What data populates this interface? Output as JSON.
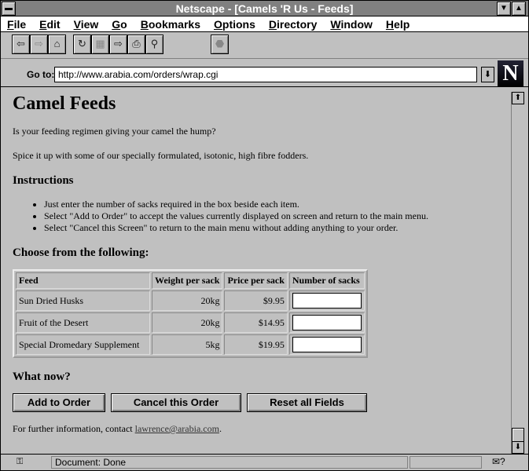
{
  "window": {
    "title": "Netscape - [Camels 'R Us - Feeds]"
  },
  "menu": [
    "File",
    "Edit",
    "View",
    "Go",
    "Bookmarks",
    "Options",
    "Directory",
    "Window",
    "Help"
  ],
  "toolbar": [
    "back",
    "forward",
    "home",
    "reload",
    "images",
    "open",
    "print",
    "find",
    "stop"
  ],
  "goto": {
    "label": "Go to:",
    "url": "http://www.arabia.com/orders/wrap.cgi"
  },
  "page": {
    "title": "Camel Feeds",
    "intro1": "Is your feeding regimen giving your camel the hump?",
    "intro2": "Spice it up with some of our specially formulated, isotonic, high fibre fodders.",
    "instructions_heading": "Instructions",
    "instructions": [
      "Just enter the number of sacks required in the box beside each item.",
      "Select \"Add to Order\" to accept the values currently displayed on screen and return to the main menu.",
      "Select \"Cancel this Screen\" to return to the main menu without adding anything to your order."
    ],
    "choose_heading": "Choose from the following:",
    "table": {
      "headers": [
        "Feed",
        "Weight per sack",
        "Price per sack",
        "Number of sacks"
      ],
      "rows": [
        {
          "feed": "Sun Dried Husks",
          "weight": "20kg",
          "price": "$9.95",
          "qty": ""
        },
        {
          "feed": "Fruit of the Desert",
          "weight": "20kg",
          "price": "$14.95",
          "qty": ""
        },
        {
          "feed": "Special Dromedary Supplement",
          "weight": "5kg",
          "price": "$19.95",
          "qty": ""
        }
      ]
    },
    "whatnow_heading": "What now?",
    "buttons": {
      "add": "Add to Order",
      "cancel": "Cancel this Order",
      "reset": "Reset all Fields"
    },
    "footer_text": "For further information, contact ",
    "footer_link": "lawrence@arabia.com",
    "footer_end": "."
  },
  "status": {
    "text": "Document: Done"
  }
}
